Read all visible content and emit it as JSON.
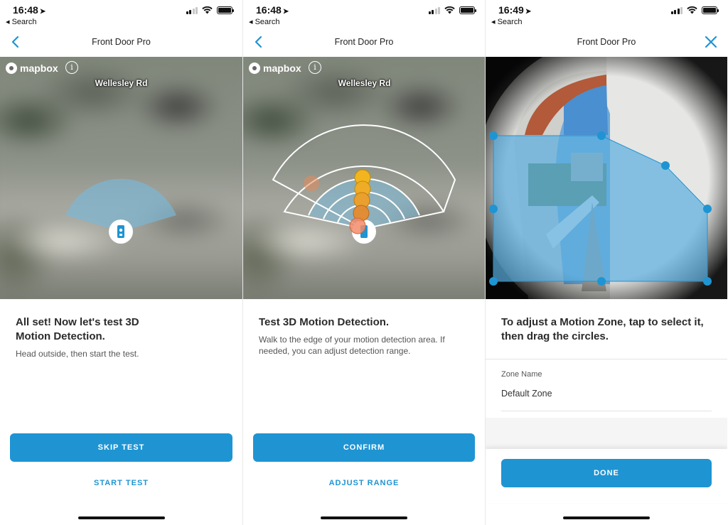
{
  "screens": [
    {
      "status": {
        "time": "16:48",
        "back_label": "Search"
      },
      "nav_title": "Front Door Pro",
      "map": {
        "attribution": "mapbox",
        "info": "i",
        "road": "Wellesley Rd"
      },
      "heading": "All set! Now let's test 3D Motion Detection.",
      "body": "Head outside, then start the test.",
      "primary_button": "SKIP TEST",
      "secondary_button": "START TEST"
    },
    {
      "status": {
        "time": "16:48",
        "back_label": "Search"
      },
      "nav_title": "Front Door Pro",
      "map": {
        "attribution": "mapbox",
        "info": "i",
        "road": "Wellesley Rd"
      },
      "heading": "Test 3D Motion Detection.",
      "body": "Walk to the edge of your motion detection area. If needed, you can adjust detection range.",
      "primary_button": "CONFIRM",
      "secondary_button": "ADJUST RANGE"
    },
    {
      "status": {
        "time": "16:49",
        "back_label": "Search"
      },
      "nav_title": "Front Door Pro",
      "heading": "To adjust a Motion Zone, tap to select it, then drag the circles.",
      "zone_name_label": "Zone Name",
      "zone_name_value": "Default Zone",
      "primary_button": "DONE"
    }
  ],
  "colors": {
    "accent": "#1f94d2",
    "zone_fill": "#5aaee0",
    "motion_dot": "#f2b51f"
  }
}
